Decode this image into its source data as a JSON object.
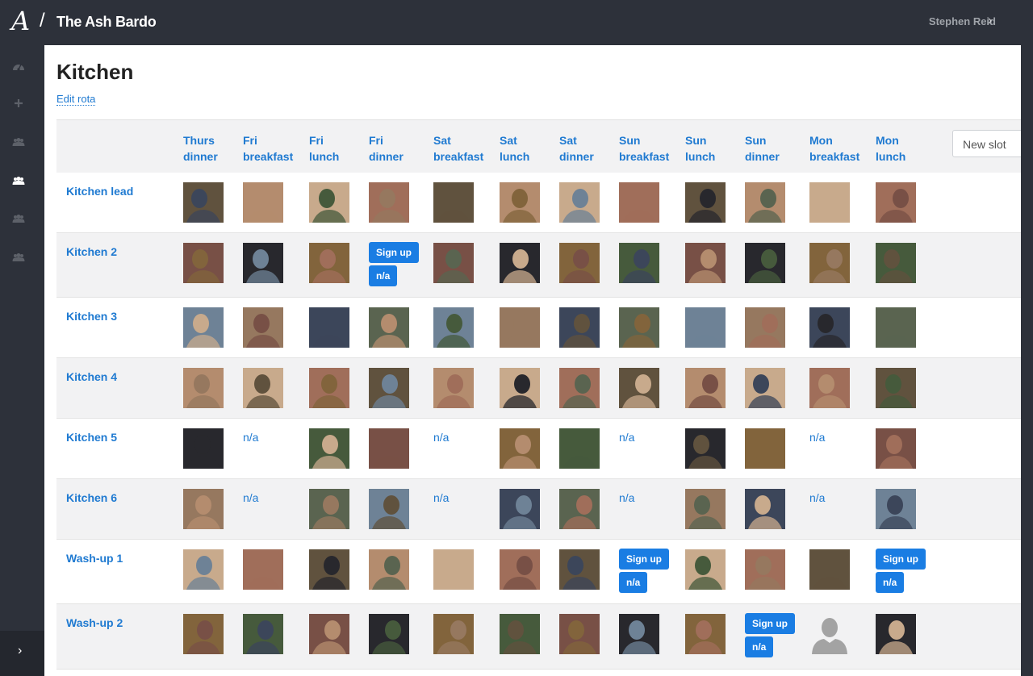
{
  "app": {
    "logo": "A",
    "separator": "/",
    "brand": "The Ash Bardo",
    "user_name": "Stephen Reid",
    "user_chevron": "›"
  },
  "sidebar": {
    "items": [
      {
        "icon": "dashboard-icon"
      },
      {
        "icon": "plus-icon"
      },
      {
        "icon": "users-icon"
      },
      {
        "icon": "users-icon-active"
      },
      {
        "icon": "users-icon"
      },
      {
        "icon": "users-icon"
      }
    ],
    "collapse_label": "›"
  },
  "page": {
    "title": "Kitchen",
    "edit_link": "Edit rota",
    "new_slot_placeholder": "New slot"
  },
  "colors": {
    "accent": "#1f7ad1",
    "button": "#1a7de3",
    "dark_bg": "#2d313a",
    "row_alt": "#f2f2f3"
  },
  "columns": [
    {
      "line1": "Thurs",
      "line2": "dinner"
    },
    {
      "line1": "Fri",
      "line2": "breakfast"
    },
    {
      "line1": "Fri",
      "line2": "lunch"
    },
    {
      "line1": "Fri",
      "line2": "dinner"
    },
    {
      "line1": "Sat",
      "line2": "breakfast"
    },
    {
      "line1": "Sat",
      "line2": "lunch"
    },
    {
      "line1": "Sat",
      "line2": "dinner"
    },
    {
      "line1": "Sun",
      "line2": "breakfast"
    },
    {
      "line1": "Sun",
      "line2": "lunch"
    },
    {
      "line1": "Sun",
      "line2": "dinner"
    },
    {
      "line1": "Mon",
      "line2": "breakfast"
    },
    {
      "line1": "Mon",
      "line2": "lunch"
    }
  ],
  "signup_label": "Sign up",
  "na_label": "n/a",
  "rows": [
    {
      "label": "Kitchen lead",
      "cells": [
        "a",
        "a",
        "a",
        "a",
        "a",
        "a",
        "a",
        "a",
        "a",
        "a",
        "a",
        "a"
      ]
    },
    {
      "label": "Kitchen 2",
      "cells": [
        "a",
        "a",
        "a",
        "signup",
        "a",
        "a",
        "a",
        "a",
        "a",
        "a",
        "a",
        "a"
      ]
    },
    {
      "label": "Kitchen 3",
      "cells": [
        "a",
        "a",
        "a",
        "a",
        "a",
        "a",
        "a",
        "a",
        "a",
        "a",
        "a",
        "a"
      ]
    },
    {
      "label": "Kitchen 4",
      "cells": [
        "a",
        "a",
        "a",
        "a",
        "a",
        "a",
        "a",
        "a",
        "a",
        "a",
        "a",
        "a"
      ]
    },
    {
      "label": "Kitchen 5",
      "cells": [
        "a",
        "na",
        "a",
        "a",
        "na",
        "a",
        "a",
        "na",
        "a",
        "a",
        "na",
        "a"
      ]
    },
    {
      "label": "Kitchen 6",
      "cells": [
        "a",
        "na",
        "a",
        "a",
        "na",
        "a",
        "a",
        "na",
        "a",
        "a",
        "na",
        "a"
      ]
    },
    {
      "label": "Wash-up 1",
      "cells": [
        "a",
        "a",
        "a",
        "a",
        "a",
        "a",
        "a",
        "signup",
        "a",
        "a",
        "a",
        "signup"
      ]
    },
    {
      "label": "Wash-up 2",
      "cells": [
        "a",
        "a",
        "a",
        "a",
        "a",
        "a",
        "a",
        "a",
        "a",
        "signup",
        "placeholder",
        "a"
      ]
    }
  ]
}
